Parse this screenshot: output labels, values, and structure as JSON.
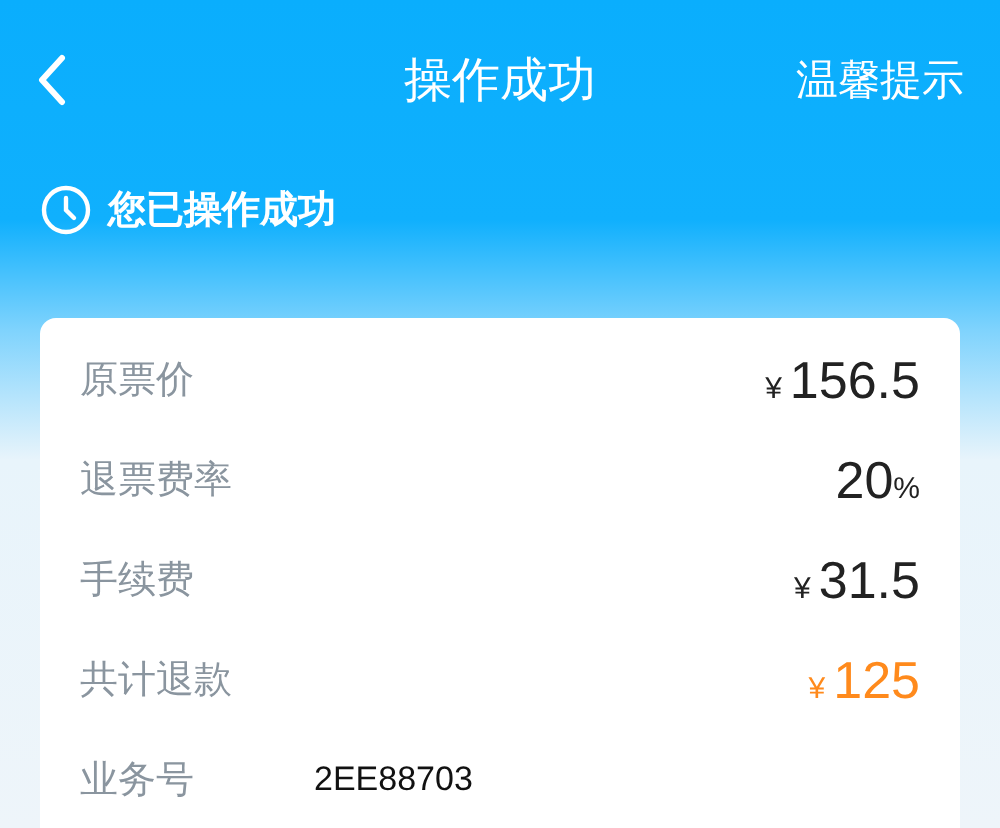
{
  "header": {
    "title": "操作成功",
    "action": "温馨提示"
  },
  "status": {
    "text": "您已操作成功"
  },
  "rows": [
    {
      "label": "原票价",
      "prefix": "¥",
      "amount": "156.5",
      "highlight": false
    },
    {
      "label": "退票费率",
      "amount": "20",
      "suffix": "%",
      "highlight": false
    },
    {
      "label": "手续费",
      "prefix": "¥",
      "amount": "31.5",
      "highlight": false
    },
    {
      "label": "共计退款",
      "prefix": "¥",
      "amount": "125",
      "highlight": true
    },
    {
      "label": "业务号",
      "code": "2EE88703"
    }
  ]
}
